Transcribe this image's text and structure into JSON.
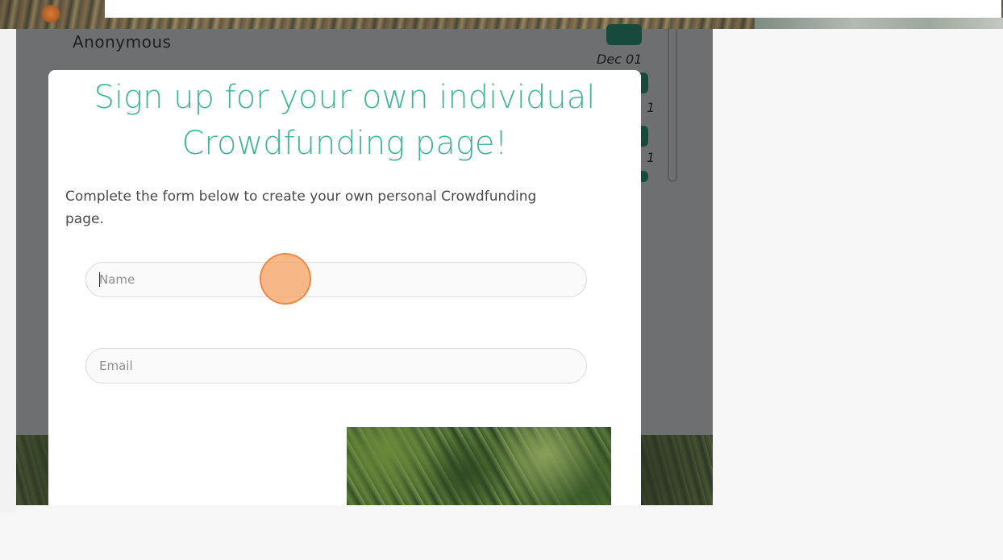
{
  "background_page": {
    "heading_fragment": "Anonymous",
    "date_label": "Dec 01",
    "partial_labels": [
      "1",
      "1"
    ]
  },
  "modal": {
    "title_line1": "Sign up for your own individual",
    "title_line2": "Crowdfunding page!",
    "description": "Complete the form below to create your own personal Crowdfunding page.",
    "fields": {
      "name_placeholder": "Name",
      "email_placeholder": "Email"
    }
  },
  "colors": {
    "title": "#3fb59b",
    "badge": "#174a3c",
    "click_marker": "#f7a466"
  }
}
